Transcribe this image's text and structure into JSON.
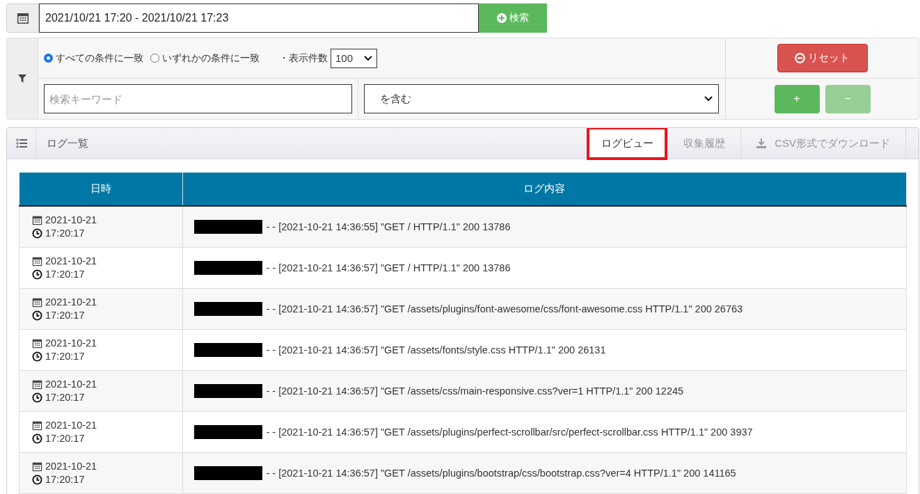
{
  "date_range": {
    "value": "2021/10/21 17:20 - 2021/10/21 17:23",
    "search_button": "検索"
  },
  "filter": {
    "match_options": [
      {
        "label": "すべての条件に一致",
        "selected": true
      },
      {
        "label": "いずれかの条件に一致",
        "selected": false
      }
    ],
    "page_size_label": "・表示件数",
    "page_size": "100",
    "keyword_placeholder": "検索キーワード",
    "condition": "を含む",
    "reset_button": "リセット",
    "add_button": "+",
    "remove_button": "−",
    "remove_disabled": true
  },
  "log_panel": {
    "title": "ログ一覧",
    "tabs": [
      {
        "label": "ログビュー",
        "selected": true,
        "highlighted": true,
        "kind": "tab"
      },
      {
        "label": "収集履歴",
        "selected": false,
        "highlighted": false,
        "kind": "tab"
      },
      {
        "label": "CSV形式でダウンロード",
        "selected": false,
        "highlighted": false,
        "kind": "download"
      }
    ],
    "table": {
      "columns": [
        "日時",
        "ログ内容"
      ],
      "rows": [
        {
          "date": "2021-10-21",
          "time": "17:20:17",
          "redacted": true,
          "log": "- - [2021-10-21 14:36:55] \"GET / HTTP/1.1\" 200 13786"
        },
        {
          "date": "2021-10-21",
          "time": "17:20:17",
          "redacted": true,
          "log": "- - [2021-10-21 14:36:57] \"GET / HTTP/1.1\" 200 13786"
        },
        {
          "date": "2021-10-21",
          "time": "17:20:17",
          "redacted": true,
          "log": "- - [2021-10-21 14:36:57] \"GET /assets/plugins/font-awesome/css/font-awesome.css HTTP/1.1\" 200 26763"
        },
        {
          "date": "2021-10-21",
          "time": "17:20:17",
          "redacted": true,
          "log": "- - [2021-10-21 14:36:57] \"GET /assets/fonts/style.css HTTP/1.1\" 200 26131"
        },
        {
          "date": "2021-10-21",
          "time": "17:20:17",
          "redacted": true,
          "log": "- - [2021-10-21 14:36:57] \"GET /assets/css/main-responsive.css?ver=1 HTTP/1.1\" 200 12245"
        },
        {
          "date": "2021-10-21",
          "time": "17:20:17",
          "redacted": true,
          "log": "- - [2021-10-21 14:36:57] \"GET /assets/plugins/perfect-scrollbar/src/perfect-scrollbar.css HTTP/1.1\" 200 3937"
        },
        {
          "date": "2021-10-21",
          "time": "17:20:17",
          "redacted": true,
          "log": "- - [2021-10-21 14:36:57] \"GET /assets/plugins/bootstrap/css/bootstrap.css?ver=4 HTTP/1.1\" 200 141165"
        }
      ]
    }
  }
}
